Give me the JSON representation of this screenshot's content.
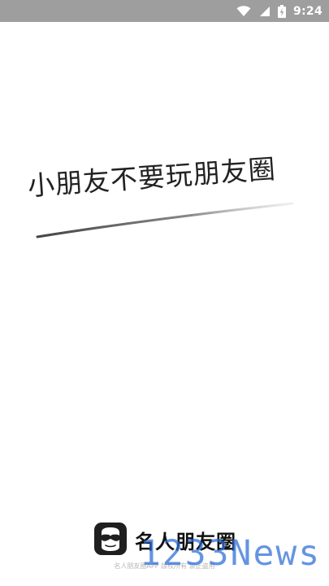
{
  "status_bar": {
    "time": "9:24",
    "icons": [
      "wifi-icon",
      "signal-icon",
      "battery-icon"
    ],
    "background": "#9e9e9e"
  },
  "splash": {
    "slogan": "小朋友不要玩朋友圈"
  },
  "footer": {
    "app_name": "名人朋友圈",
    "copyright": "名人朋友圈APP 版权所有 禁止盗用",
    "logo_icon": "sunglasses-mask-icon"
  },
  "watermark": {
    "text": "1233News",
    "color": "#2a6cd6"
  }
}
